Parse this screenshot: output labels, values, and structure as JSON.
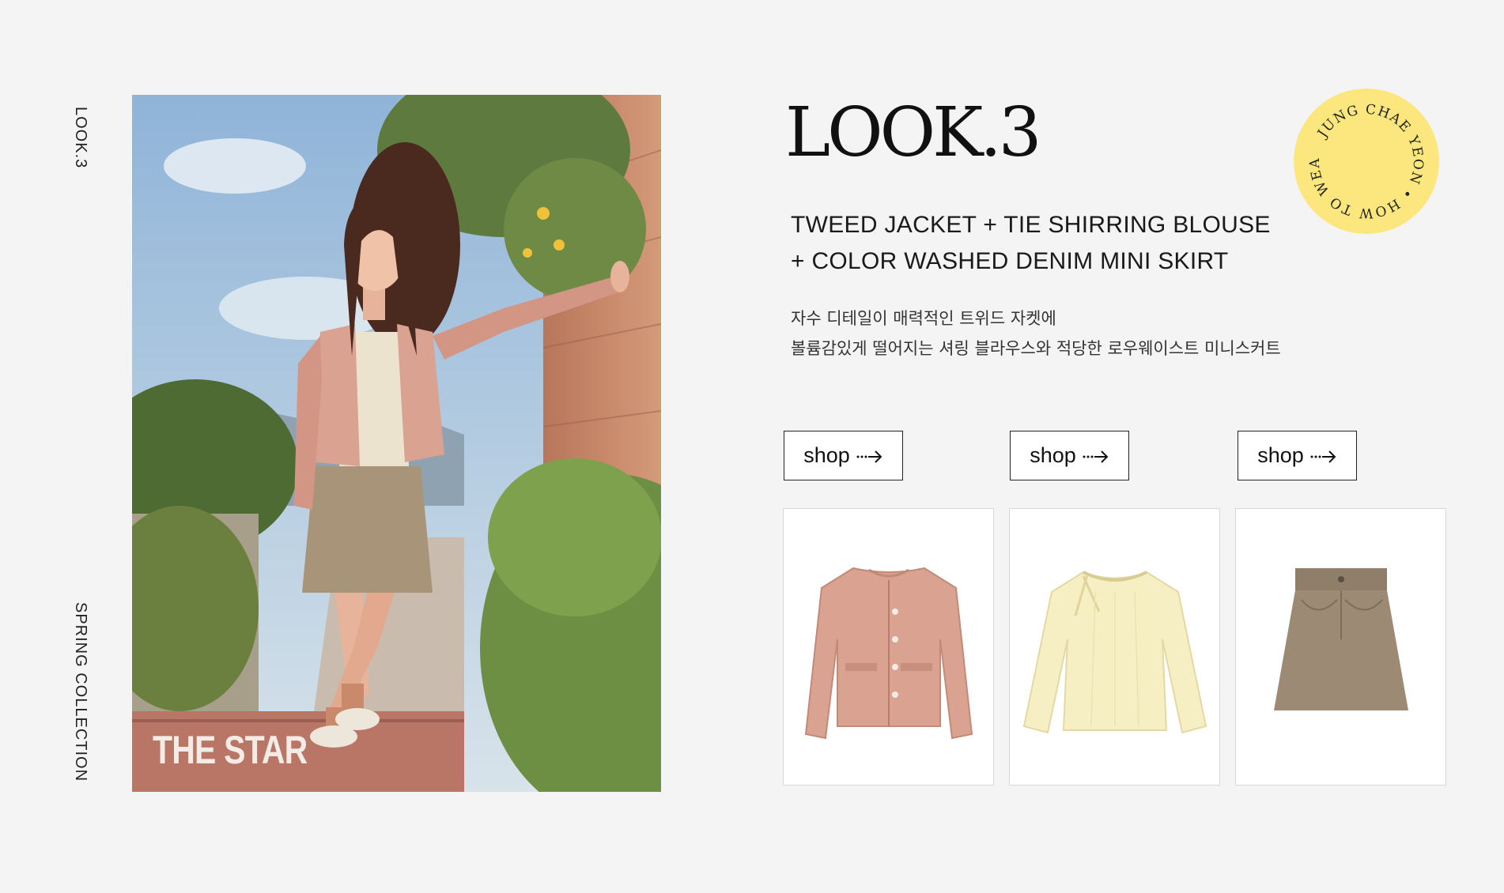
{
  "side": {
    "top_label": "LOOK.3",
    "bottom_label": "SPRING COLLECTION"
  },
  "hero": {
    "brand_logo": "THE STAR"
  },
  "look": {
    "title": "LOOK.3",
    "products_line1": "TWEED JACKET + TIE SHIRRING BLOUSE",
    "products_line2": "+ COLOR WASHED DENIM MINI SKIRT",
    "desc_line1": "자수 디테일이 매력적인 트위드 자켓에",
    "desc_line2": "볼륨감있게 떨어지는 셔링 블라우스와 적당한 로우웨이스트 미니스커트"
  },
  "badge": {
    "circle_text": "JUNG CHAE YEON • HOW TO WEAR •",
    "color": "#fbe77e"
  },
  "shop": {
    "labels": [
      "shop",
      "shop",
      "shop"
    ]
  },
  "products": [
    {
      "name": "tweed-jacket",
      "color": "#d9a291"
    },
    {
      "name": "tie-shirring-blouse",
      "color": "#f7efc4"
    },
    {
      "name": "color-washed-denim-mini-skirt",
      "color": "#9c8a74"
    }
  ]
}
